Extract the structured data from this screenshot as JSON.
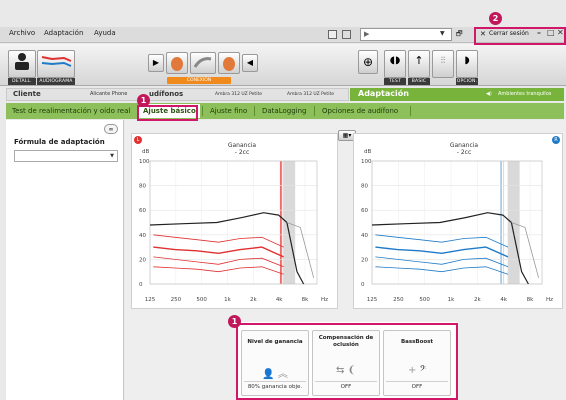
{
  "menu": {
    "items": [
      "Archivo",
      "Adaptación",
      "Ayuda"
    ]
  },
  "toolbar": {
    "detail_label": "DETALL.",
    "audiogram_label": "AUDIOGRAMA",
    "connection_label": "CONEXIÓN",
    "test_label": "TEST",
    "basic_label": "BASIC",
    "options_label": "OPCION.",
    "session_label": "Cerrar sesión"
  },
  "header": {
    "client_label": "Cliente",
    "client_name": "Alicante Phone",
    "devices_label": "udífonos",
    "device_left": "Ambra 312 UZ Petite",
    "device_right": "Ambra 312 UZ Petite",
    "section_title": "Adaptación",
    "environment": "Ambientes tranquilos"
  },
  "tabs": [
    {
      "label": "Test de realimentación y oído real"
    },
    {
      "label": "Ajuste básico"
    },
    {
      "label": "Ajuste fino"
    },
    {
      "label": "DataLogging"
    },
    {
      "label": "Opciones de audífono"
    }
  ],
  "left_panel": {
    "formula_label": "Fórmula de adaptación",
    "formula_value": ""
  },
  "chart_data": [
    {
      "type": "line",
      "ear": "left",
      "title": "Ganancia",
      "subtitle": "- 2cc",
      "ylabel": "dB",
      "xlabel": "Hz",
      "x_ticks": [
        "125",
        "250",
        "500",
        "1k",
        "2k",
        "4k",
        "8k"
      ],
      "y_ticks": [
        "0",
        "20",
        "40",
        "60",
        "80",
        "100"
      ],
      "ylim": [
        0,
        100
      ],
      "color": "#e03030"
    },
    {
      "type": "line",
      "ear": "right",
      "title": "Ganancia",
      "subtitle": "- 2cc",
      "ylabel": "dB",
      "xlabel": "Hz",
      "x_ticks": [
        "125",
        "250",
        "500",
        "1k",
        "2k",
        "4k",
        "8k"
      ],
      "y_ticks": [
        "0",
        "20",
        "40",
        "60",
        "80",
        "100"
      ],
      "ylim": [
        0,
        100
      ],
      "color": "#1f7bc8"
    }
  ],
  "features": [
    {
      "title": "Nivel de ganancia",
      "value": "80% ganancia obje."
    },
    {
      "title": "Compensación de oclusión",
      "value": "OFF"
    },
    {
      "title": "BassBoost",
      "value": "OFF"
    }
  ],
  "callouts": [
    "1",
    "2",
    "1"
  ]
}
